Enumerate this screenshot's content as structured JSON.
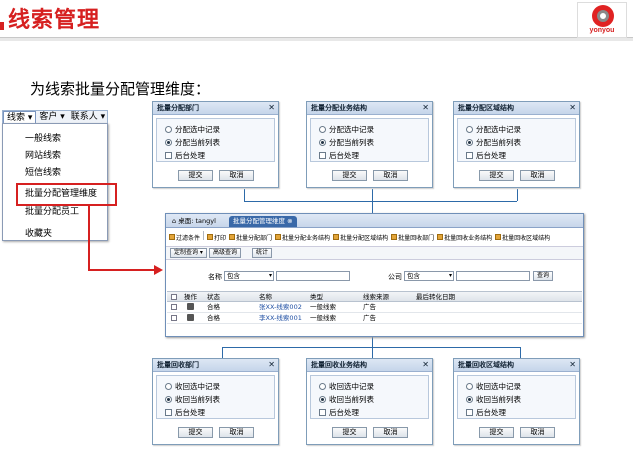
{
  "header": {
    "title": "线索管理",
    "logo_text": "yonyou"
  },
  "intro": "为线索批量分配管理维度：",
  "menubar": {
    "items": [
      "线索 ▾",
      "客户 ▾",
      "联系人 ▾"
    ]
  },
  "menu": {
    "items": [
      "一般线索",
      "网站线索",
      "短信线索",
      "批量分配管理维度",
      "批量分配员工",
      "收藏夹"
    ]
  },
  "dialogs_top": [
    {
      "title": "批量分配部门",
      "options": [
        "分配选中记录",
        "分配当前列表"
      ],
      "checkbox": "后台处理",
      "submit": "提交",
      "cancel": "取消"
    },
    {
      "title": "批量分配业务结构",
      "options": [
        "分配选中记录",
        "分配当前列表"
      ],
      "checkbox": "后台处理",
      "submit": "提交",
      "cancel": "取消"
    },
    {
      "title": "批量分配区域结构",
      "options": [
        "分配选中记录",
        "分配当前列表"
      ],
      "checkbox": "后台处理",
      "submit": "提交",
      "cancel": "取消"
    }
  ],
  "dialogs_bottom": [
    {
      "title": "批量回收部门",
      "options": [
        "收回选中记录",
        "收回当前列表"
      ],
      "checkbox": "后台处理",
      "submit": "提交",
      "cancel": "取消"
    },
    {
      "title": "批量回收业务结构",
      "options": [
        "收回选中记录",
        "收回当前列表"
      ],
      "checkbox": "后台处理",
      "submit": "提交",
      "cancel": "取消"
    },
    {
      "title": "批量回收区域结构",
      "options": [
        "收回选中记录",
        "收回当前列表"
      ],
      "checkbox": "后台处理",
      "submit": "提交",
      "cancel": "取消"
    }
  ],
  "main": {
    "tab_home": "桌面: tangyl",
    "tab_active": "批量分配管理维度",
    "toolbar": [
      "过滤条件",
      "打印",
      "批量分配部门",
      "批量分配业务结构",
      "批量分配区域结构",
      "批量回收部门",
      "批量回收业务结构",
      "批量回收区域结构"
    ],
    "sub_buttons": [
      "定制查询 ▾",
      "高级查询",
      "统计"
    ],
    "query": {
      "name_label": "名称",
      "name_op": "包含",
      "company_label": "公司",
      "company_op": "包含",
      "query_button": "查询"
    },
    "columns": [
      "操作",
      "状态",
      "名称",
      "类型",
      "线索来源",
      "最后转化日期"
    ],
    "rows": [
      {
        "status": "合格",
        "name": "张XX-线索002",
        "type": "一般线索",
        "source": "广告",
        "date": ""
      },
      {
        "status": "合格",
        "name": "李XX-线索001",
        "type": "一般线索",
        "source": "广告",
        "date": ""
      }
    ]
  },
  "colors": {
    "accent": "#d62020",
    "connector": "#2d6aa8"
  }
}
